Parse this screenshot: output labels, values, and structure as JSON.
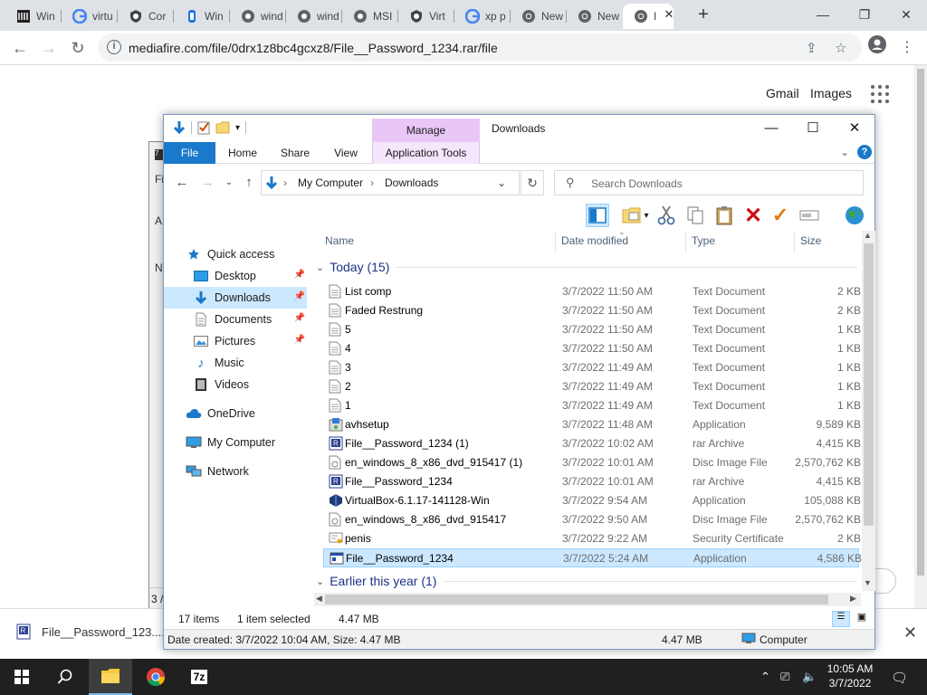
{
  "browser": {
    "tabs": [
      {
        "label": "Win",
        "icon": "archive-icon"
      },
      {
        "label": "virtu",
        "icon": "google-icon"
      },
      {
        "label": "Cor",
        "icon": "shield-icon"
      },
      {
        "label": "Win",
        "icon": "document-icon"
      },
      {
        "label": "wind",
        "icon": "globe-icon"
      },
      {
        "label": "wind",
        "icon": "globe-icon"
      },
      {
        "label": "MSI",
        "icon": "globe-icon"
      },
      {
        "label": "Virt",
        "icon": "shield-icon"
      },
      {
        "label": "xp p",
        "icon": "google-icon"
      },
      {
        "label": "New",
        "icon": "chrome-icon"
      },
      {
        "label": "New",
        "icon": "chrome-icon"
      },
      {
        "label": "I",
        "icon": "chrome-icon"
      }
    ],
    "url": "mediafire.com/file/0drx1z8bc4gcxz8/File__Password_1234.rar/file"
  },
  "page": {
    "gmail": "Gmail",
    "images": "Images"
  },
  "download_bar": {
    "filename": "File__Password_123....rar"
  },
  "explorer": {
    "window_title": "Downloads",
    "manage_label": "Manage",
    "ribbon_tabs": [
      "File",
      "Home",
      "Share",
      "View",
      "Application Tools"
    ],
    "address": [
      "My Computer",
      "Downloads"
    ],
    "search_placeholder": "Search Downloads",
    "nav": {
      "quick_access": "Quick access",
      "desktop": "Desktop",
      "downloads": "Downloads",
      "documents": "Documents",
      "pictures": "Pictures",
      "music": "Music",
      "videos": "Videos",
      "onedrive": "OneDrive",
      "my_computer": "My Computer",
      "network": "Network"
    },
    "columns": [
      "Name",
      "Date modified",
      "Type",
      "Size"
    ],
    "group_today": "Today (15)",
    "group_earlier": "Earlier this year (1)",
    "files": [
      {
        "name": "List comp",
        "date": "3/7/2022 11:50 AM",
        "type": "Text Document",
        "size": "2 KB",
        "icon": "text-file-icon"
      },
      {
        "name": "Faded Restrung",
        "date": "3/7/2022 11:50 AM",
        "type": "Text Document",
        "size": "2 KB",
        "icon": "text-file-icon"
      },
      {
        "name": "5",
        "date": "3/7/2022 11:50 AM",
        "type": "Text Document",
        "size": "1 KB",
        "icon": "text-file-icon"
      },
      {
        "name": "4",
        "date": "3/7/2022 11:50 AM",
        "type": "Text Document",
        "size": "1 KB",
        "icon": "text-file-icon"
      },
      {
        "name": "3",
        "date": "3/7/2022 11:49 AM",
        "type": "Text Document",
        "size": "1 KB",
        "icon": "text-file-icon"
      },
      {
        "name": "2",
        "date": "3/7/2022 11:49 AM",
        "type": "Text Document",
        "size": "1 KB",
        "icon": "text-file-icon"
      },
      {
        "name": "1",
        "date": "3/7/2022 11:49 AM",
        "type": "Text Document",
        "size": "1 KB",
        "icon": "text-file-icon"
      },
      {
        "name": "avhsetup",
        "date": "3/7/2022 11:48 AM",
        "type": "Application",
        "size": "9,589 KB",
        "icon": "setup-icon"
      },
      {
        "name": "File__Password_1234 (1)",
        "date": "3/7/2022 10:02 AM",
        "type": "rar Archive",
        "size": "4,415 KB",
        "icon": "rar-archive-icon"
      },
      {
        "name": "en_windows_8_x86_dvd_915417 (1)",
        "date": "3/7/2022 10:01 AM",
        "type": "Disc Image File",
        "size": "2,570,762 KB",
        "icon": "disc-image-icon"
      },
      {
        "name": "File__Password_1234",
        "date": "3/7/2022 10:01 AM",
        "type": "rar Archive",
        "size": "4,415 KB",
        "icon": "rar-archive-icon"
      },
      {
        "name": "VirtualBox-6.1.17-141128-Win",
        "date": "3/7/2022 9:54 AM",
        "type": "Application",
        "size": "105,088 KB",
        "icon": "virtualbox-icon"
      },
      {
        "name": "en_windows_8_x86_dvd_915417",
        "date": "3/7/2022 9:50 AM",
        "type": "Disc Image File",
        "size": "2,570,762 KB",
        "icon": "disc-image-icon"
      },
      {
        "name": "penis",
        "date": "3/7/2022 9:22 AM",
        "type": "Security Certificate",
        "size": "2 KB",
        "icon": "certificate-icon"
      },
      {
        "name": "File__Password_1234",
        "date": "3/7/2022 5:24 AM",
        "type": "Application",
        "size": "4,586 KB",
        "icon": "application-icon",
        "selected": true
      }
    ],
    "status": {
      "items": "17 items",
      "selected": "1 item selected",
      "size": "4.47 MB"
    },
    "info": {
      "details": "Date created: 3/7/2022 10:04 AM, Size: 4.47 MB",
      "size": "4.47 MB",
      "location": "Computer"
    }
  },
  "taskbar": {
    "time": "10:05 AM",
    "date": "3/7/2022"
  },
  "background_window": {
    "label": "3 /"
  }
}
